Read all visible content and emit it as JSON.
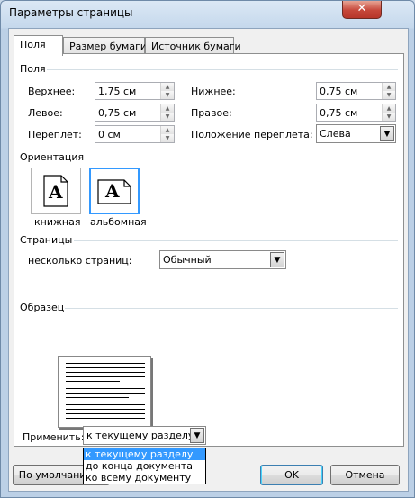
{
  "window": {
    "title": "Параметры страницы",
    "close_glyph": "✕"
  },
  "tabs": [
    {
      "label": "Поля",
      "active": true
    },
    {
      "label": "Размер бумаги",
      "active": false
    },
    {
      "label": "Источник бумаги",
      "active": false
    }
  ],
  "margins": {
    "section_label": "Поля",
    "top": {
      "label": "Верхнее:",
      "value": "1,75 см"
    },
    "bottom": {
      "label": "Нижнее:",
      "value": "0,75 см"
    },
    "left": {
      "label": "Левое:",
      "value": "0,75 см"
    },
    "right": {
      "label": "Правое:",
      "value": "0,75 см"
    },
    "gutter": {
      "label": "Переплет:",
      "value": "0 см"
    },
    "gutter_position": {
      "label": "Положение переплета:",
      "value": "Слева"
    }
  },
  "orientation": {
    "section_label": "Ориентация",
    "portrait": {
      "label": "книжная",
      "glyph": "A"
    },
    "landscape": {
      "label": "альбомная",
      "glyph": "A",
      "selected": true
    }
  },
  "pages": {
    "section_label": "Страницы",
    "multiple_label": "несколько страниц:",
    "multiple_value": "Обычный"
  },
  "preview": {
    "section_label": "Образец"
  },
  "apply": {
    "label": "Применить:",
    "value": "к текущему разделу",
    "options": [
      "к текущему разделу",
      "до конца документа",
      "ко всему документу"
    ],
    "highlighted_index": 0
  },
  "buttons": {
    "default": "По умолчанию...",
    "ok": "OK",
    "cancel": "Отмена"
  },
  "icons": {
    "dropdown": "▼",
    "spin_up": "▲",
    "spin_down": "▼"
  }
}
